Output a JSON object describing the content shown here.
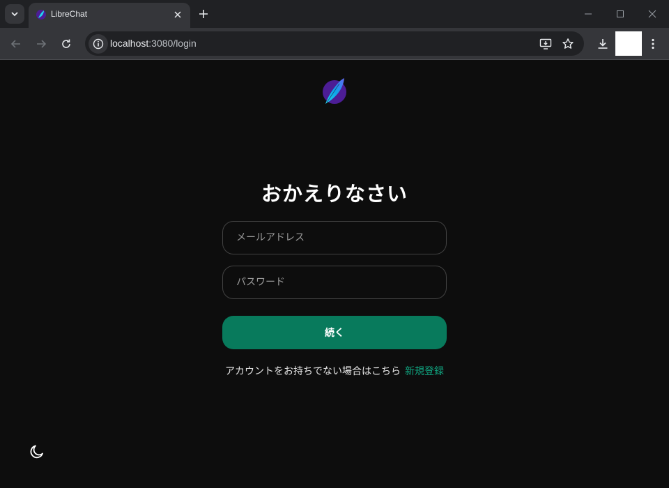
{
  "browser": {
    "tab_title": "LibreChat",
    "url_host": "localhost",
    "url_rest": ":3080/login",
    "icons": {
      "tab_search": "chevron-down-icon",
      "tab_close": "close-icon",
      "new_tab": "plus-icon",
      "minimize": "minimize-icon",
      "maximize": "maximize-icon",
      "close_window": "close-icon",
      "back": "arrow-left-icon",
      "forward": "arrow-right-icon",
      "reload": "reload-icon",
      "site_info": "info-icon",
      "install": "install-app-icon",
      "bookmark": "star-icon",
      "download": "download-icon",
      "menu": "kebab-menu-icon"
    }
  },
  "login": {
    "heading": "おかえりなさい",
    "email_placeholder": "メールアドレス",
    "password_placeholder": "パスワード",
    "continue_label": "続く",
    "signup_prompt": "アカウントをお持ちでない場合はこちら",
    "signup_link": "新規登録"
  },
  "colors": {
    "page_bg": "#0d0d0d",
    "button_green": "#087a5c",
    "link_green": "#10a37f"
  }
}
